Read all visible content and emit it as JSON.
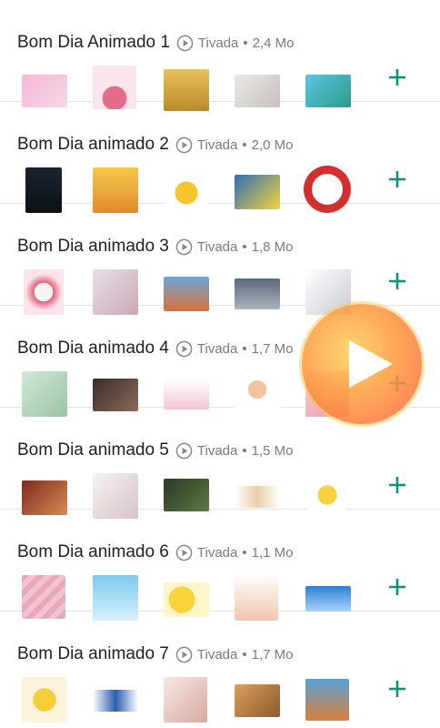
{
  "packs": [
    {
      "name": "Bom Dia Animado 1",
      "publisher": "Tivada",
      "size": "2,4 Mo"
    },
    {
      "name": "Bom Dia animado 2",
      "publisher": "Tivada",
      "size": "2,0 Mo"
    },
    {
      "name": "Bom Dia animado 3",
      "publisher": "Tivada",
      "size": "1,8 Mo"
    },
    {
      "name": "Bom Dia animado 4",
      "publisher": "Tivada",
      "size": "1,7 Mo"
    },
    {
      "name": "Bom Dia animado 5",
      "publisher": "Tivada",
      "size": "1,5 Mo"
    },
    {
      "name": "Bom Dia animado 6",
      "publisher": "Tivada",
      "size": "1,1 Mo"
    },
    {
      "name": "Bom Dia animado 7",
      "publisher": "Tivada",
      "size": "1,7 Mo"
    }
  ],
  "separator": "•",
  "colors": {
    "accent": "#0f8f7e",
    "play": "#8a8a8a",
    "overlay": "#ff7a3c"
  },
  "icons": {
    "play": "play-circle-icon",
    "add": "plus-icon",
    "overlay": "video-play-icon"
  }
}
